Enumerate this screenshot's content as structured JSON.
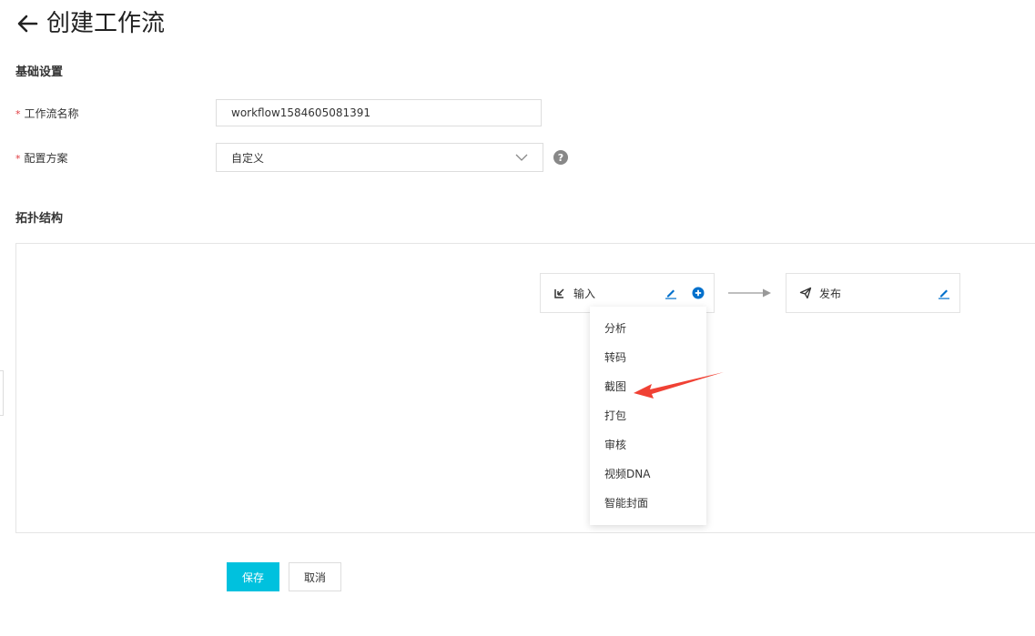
{
  "header": {
    "title": "创建工作流"
  },
  "basic_section": {
    "title": "基础设置"
  },
  "form": {
    "required_mark": "*",
    "name_label": "工作流名称",
    "name_value": "workflow1584605081391",
    "scheme_label": "配置方案",
    "scheme_value": "自定义",
    "help_glyph": "?"
  },
  "topology_section": {
    "title": "拓扑结构"
  },
  "nodes": {
    "input": {
      "label": "输入",
      "icon": "input-arrow-icon"
    },
    "publish": {
      "label": "发布",
      "icon": "send-icon"
    }
  },
  "menu": {
    "items": [
      "分析",
      "转码",
      "截图",
      "打包",
      "审核",
      "视频DNA",
      "智能封面"
    ]
  },
  "buttons": {
    "save": "保存",
    "cancel": "取消"
  },
  "colors": {
    "primary": "#00c1de",
    "link_blue": "#0070cc",
    "required_red": "#e0393e",
    "annotation_red": "#f04134"
  }
}
